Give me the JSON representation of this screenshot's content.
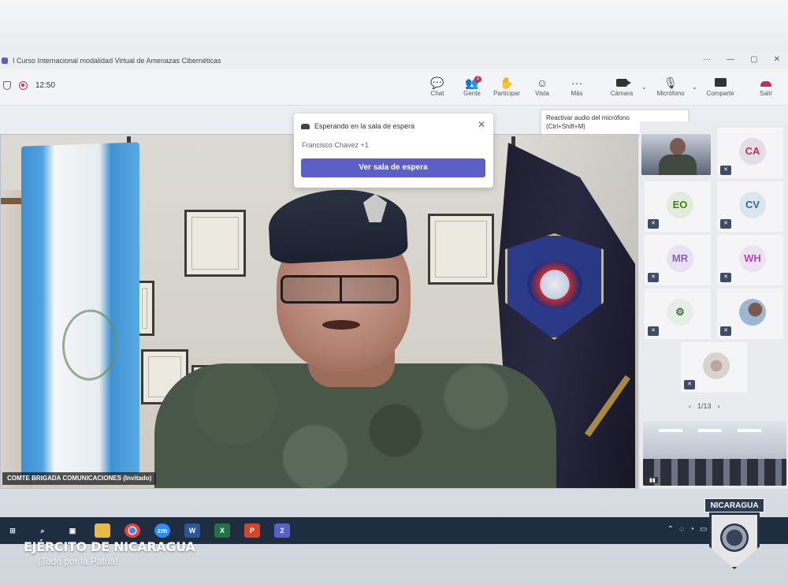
{
  "window": {
    "title": "I Curso Internacional modalidad Virtual de Amenazas Cibernéticas"
  },
  "toolbar": {
    "time": "12:50",
    "buttons": [
      {
        "label": "Chat",
        "icon": "chat-icon"
      },
      {
        "label": "Gente",
        "icon": "people-icon",
        "badge": "2"
      },
      {
        "label": "Participar",
        "icon": "raise-hand-icon"
      },
      {
        "label": "Vista",
        "icon": "view-icon"
      },
      {
        "label": "Más",
        "icon": "more-icon"
      },
      {
        "label": "Cámara",
        "icon": "camera-icon"
      },
      {
        "label": "Micrófono",
        "icon": "microphone-icon"
      },
      {
        "label": "Comparte",
        "icon": "share-icon"
      },
      {
        "label": "Salir",
        "icon": "leave-icon"
      }
    ]
  },
  "tooltip": {
    "line1": "Reactivar audio del micrófono",
    "line2": "(Ctrl+Shift+M)"
  },
  "lobby": {
    "title": "Esperando en la sala de espera",
    "waiting": "Francisco Chavez +1",
    "button": "Ver sala de espera"
  },
  "main_video": {
    "name_tag": "COMTE BRIGADA COMUNICACIONES (Invitado)"
  },
  "participants": [
    {
      "initials": "CA",
      "color": "#c4314b"
    },
    {
      "initials": "EO",
      "color": "#498205"
    },
    {
      "initials": "CV",
      "color": "#2d6aa0"
    },
    {
      "initials": "MR",
      "color": "#8764b8"
    },
    {
      "initials": "WH",
      "color": "#b146c2"
    }
  ],
  "pager": {
    "text": "1/13"
  },
  "taskbar": {
    "apps": [
      "windows-start",
      "search",
      "task-view",
      "file-explorer",
      "chrome",
      "zoom",
      "word",
      "excel",
      "powerpoint",
      "teams"
    ],
    "teams_badge": "2"
  },
  "watermark": {
    "brand": "EJÉRCITO DE NICARAGUA",
    "motto": "¡Todo por la Patria!",
    "seal_banner": "NICARAGUA"
  },
  "colors": {
    "teams_purple": "#5b5fc7",
    "leave_red": "#c4314b",
    "taskbar": "#1f2d40"
  }
}
